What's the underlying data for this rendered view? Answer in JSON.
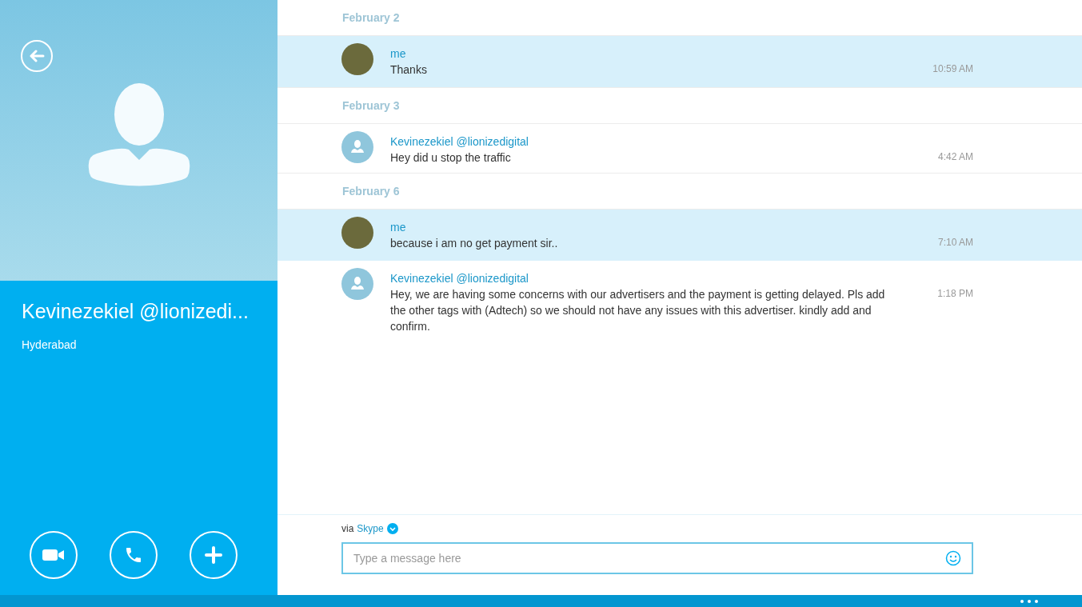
{
  "contact": {
    "name": "Kevinezekiel @lionizedi...",
    "location": "Hyderabad"
  },
  "days": [
    {
      "date": "February 2",
      "messages": [
        {
          "kind": "own",
          "sender": "me",
          "text": "Thanks",
          "time": "10:59 AM"
        }
      ]
    },
    {
      "date": "February 3",
      "messages": [
        {
          "kind": "contact",
          "sender": "Kevinezekiel @lionizedigital",
          "text": "Hey did u stop the traffic",
          "time": "4:42 AM"
        }
      ]
    },
    {
      "date": "February 6",
      "messages": [
        {
          "kind": "own",
          "sender": "me",
          "text": "because i am no get payment sir..",
          "time": "7:10 AM"
        },
        {
          "kind": "contact",
          "sender": "Kevinezekiel @lionizedigital",
          "text": "Hey, we are having some concerns with our advertisers and the payment is getting delayed. Pls add the other tags with (Adtech) so we should not have any issues with this advertiser. kindly add and confirm.",
          "time": "1:18 PM"
        }
      ]
    }
  ],
  "compose": {
    "via_label": "via",
    "service": "Skype",
    "placeholder": "Type a message here"
  }
}
